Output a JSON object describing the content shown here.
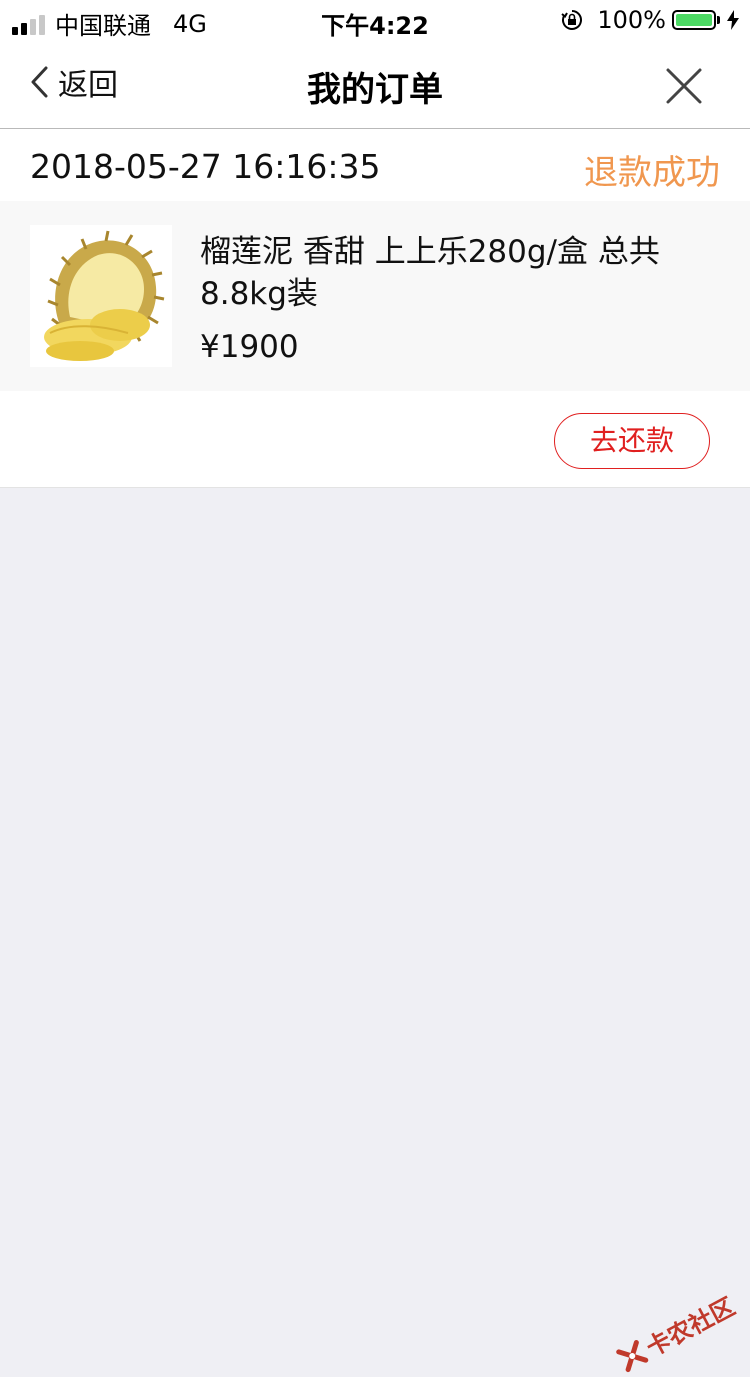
{
  "status_bar": {
    "carrier": "中国联通",
    "network": "4G",
    "time": "下午4:22",
    "battery_percent": "100%",
    "signal_bars": 4,
    "signal_bars_active": 2
  },
  "nav": {
    "back_label": "返回",
    "title": "我的订单",
    "close_icon": "close-icon"
  },
  "order": {
    "datetime": "2018-05-27 16:16:35",
    "status": "退款成功",
    "status_color": "#f0974f",
    "product_name": "榴莲泥 香甜 上上乐280g/盒 总共8.8kg装",
    "product_image": "durian-image",
    "price": "¥1900",
    "action_label": "去还款",
    "action_color": "#e02020"
  },
  "watermark": {
    "text": "卡农社区"
  }
}
